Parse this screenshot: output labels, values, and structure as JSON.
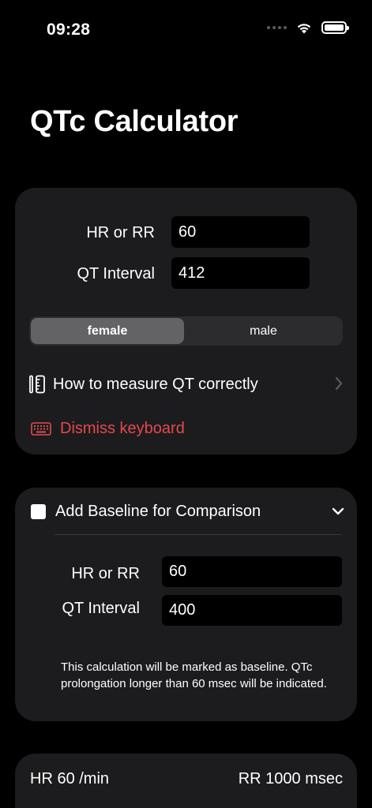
{
  "status_bar": {
    "time": "09:28"
  },
  "title": "QTc Calculator",
  "inputs": {
    "hr_label": "HR or RR",
    "hr_value": "60",
    "qt_label": "QT Interval",
    "qt_value": "412"
  },
  "gender": {
    "options": [
      "female",
      "male"
    ],
    "selected": "female"
  },
  "measure_link": {
    "label": "How to measure QT correctly"
  },
  "dismiss": {
    "label": "Dismiss keyboard",
    "color": "#e5484d"
  },
  "baseline": {
    "title": "Add Baseline for Comparison",
    "checked": false,
    "hr_label": "HR or RR",
    "hr_value": "60",
    "qt_label": "QT Interval",
    "qt_value": "400",
    "note": "This calculation will be marked as baseline. QTc prolongation longer than 60 msec will be indicated."
  },
  "result": {
    "hr": "HR 60 /min",
    "rr": "RR 1000 msec"
  }
}
